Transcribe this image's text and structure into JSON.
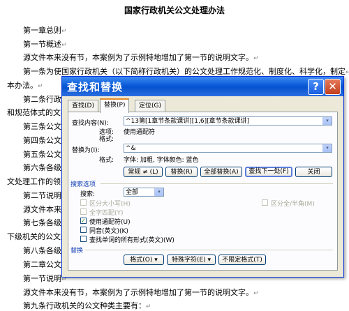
{
  "document": {
    "title": "国家行政机关公文处理办法",
    "pilcrow": "↵",
    "lines": [
      "第一章总则",
      "第一节概述",
      "源文件本来没有节，本案例为了示例特地增加了第一节的说明文字。",
      "第一条为使国家行政机关（以下简称行政机关）的公文处理工作规范化、制度化、科学化，制定",
      "本办法。",
      "第二条行政机",
      "和规范体式的文",
      "第三条公文处",
      "第四条公文处",
      "第五条公文处",
      "第六条各级行",
      "文处理工作的领",
      "第二节说明",
      "源文件本来没",
      "第七条各级行",
      "下级机关的公文处",
      "第八条各级行",
      "第二章公文种",
      "第一节说明",
      "源文件本来没有节，本案例为了示例特地增加了第一节的说明文字。",
      "第九条行政机关的公文种类主要有："
    ]
  },
  "dialog": {
    "title": "查找和替换",
    "help_label": "?",
    "close_label": "✕",
    "tabs": [
      "查找(D)",
      "替换(P)",
      "定位(G)"
    ],
    "find_label": "查找内容(N):",
    "find_value": "^13第[1章节条款课讲][1,6][章节条款课讲]",
    "options_label": "选项:",
    "options_value": "使用通配符",
    "format_label": "格式:",
    "replace_label": "替换为(I):",
    "replace_value": "^&",
    "replace_format_label": "格式:",
    "replace_format_value": "字体: 加粗, 字体颜色: 蓝色",
    "buttons": [
      "常规 ≠ (L)",
      "替换(R)",
      "全部替换(A)",
      "查找下一处(F)",
      "关闭"
    ],
    "search_options_title": "搜索选项",
    "search_label": "搜索:",
    "search_value": "全部",
    "opt_match_case": "区分大小写(H)",
    "opt_whole_word": "全字匹配(Y)",
    "opt_wildcards": "使用通配符(U)",
    "opt_sounds_like": "同音(英文)(K)",
    "opt_all_forms": "查找单词的所有形式(英文)(W)",
    "opt_full_half": "区分全/半角(M)",
    "replace_section_title": "替换",
    "bottom_buttons": [
      "格式(O) ▾",
      "特殊字符(E) ▾",
      "不限定格式(T)"
    ],
    "checked_mark": "✓",
    "dropdown_arrow": "▾"
  }
}
